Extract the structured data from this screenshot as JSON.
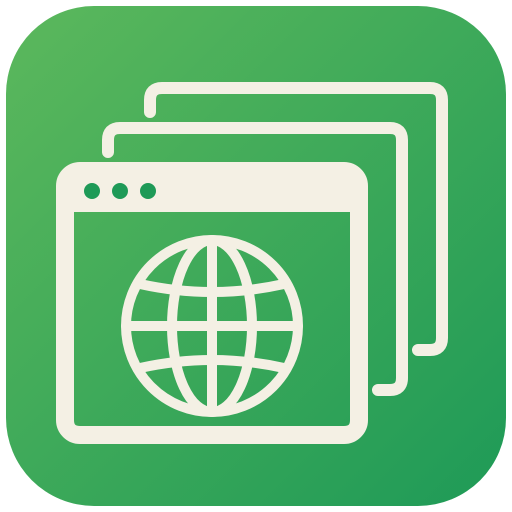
{
  "app_icon": {
    "name": "multi-window-browser-app-icon",
    "description_icon": "stacked-browser-windows-globe-icon",
    "colors": {
      "gradient_start": "#5CB85C",
      "gradient_end": "#1E9A57",
      "foreground": "#F4F0E4"
    },
    "window_count": 3,
    "title_bar_dots": 3
  }
}
